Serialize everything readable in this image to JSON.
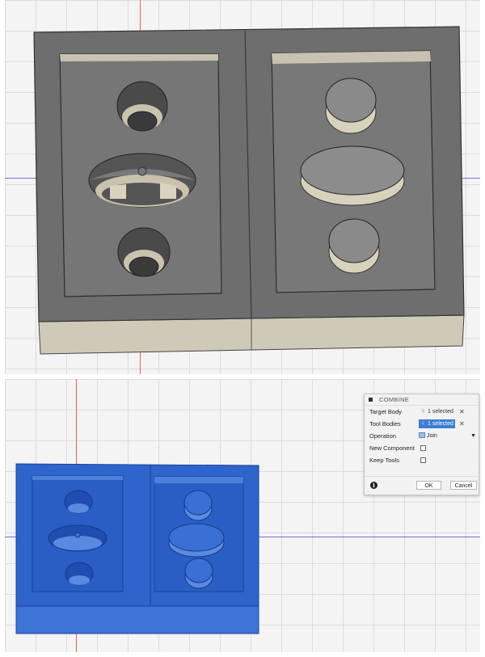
{
  "combine_dialog": {
    "title": "COMBINE",
    "target_body": {
      "label": "Target Body",
      "value": "1 selected"
    },
    "tool_bodies": {
      "label": "Tool Bodies",
      "value": "1 selected"
    },
    "operation": {
      "label": "Operation",
      "value": "Join"
    },
    "new_component": {
      "label": "New Component",
      "checked": false
    },
    "keep_tools": {
      "label": "Keep Tools",
      "checked": false
    },
    "ok_label": "OK",
    "cancel_label": "Cancel",
    "close_glyph": "✕"
  },
  "colors": {
    "grid_background": "#f4f4f4",
    "body_gray": "#6e6e6e",
    "body_side": "#cfc9b8",
    "selection_blue": "#2e64cc",
    "axis_red": "#e96060",
    "axis_blue": "#7070d8",
    "dialog_highlight": "#3b7fd4"
  },
  "icons": [
    "info-icon",
    "cursor-icon",
    "close-icon",
    "join-icon",
    "dropdown-caret-icon"
  ]
}
